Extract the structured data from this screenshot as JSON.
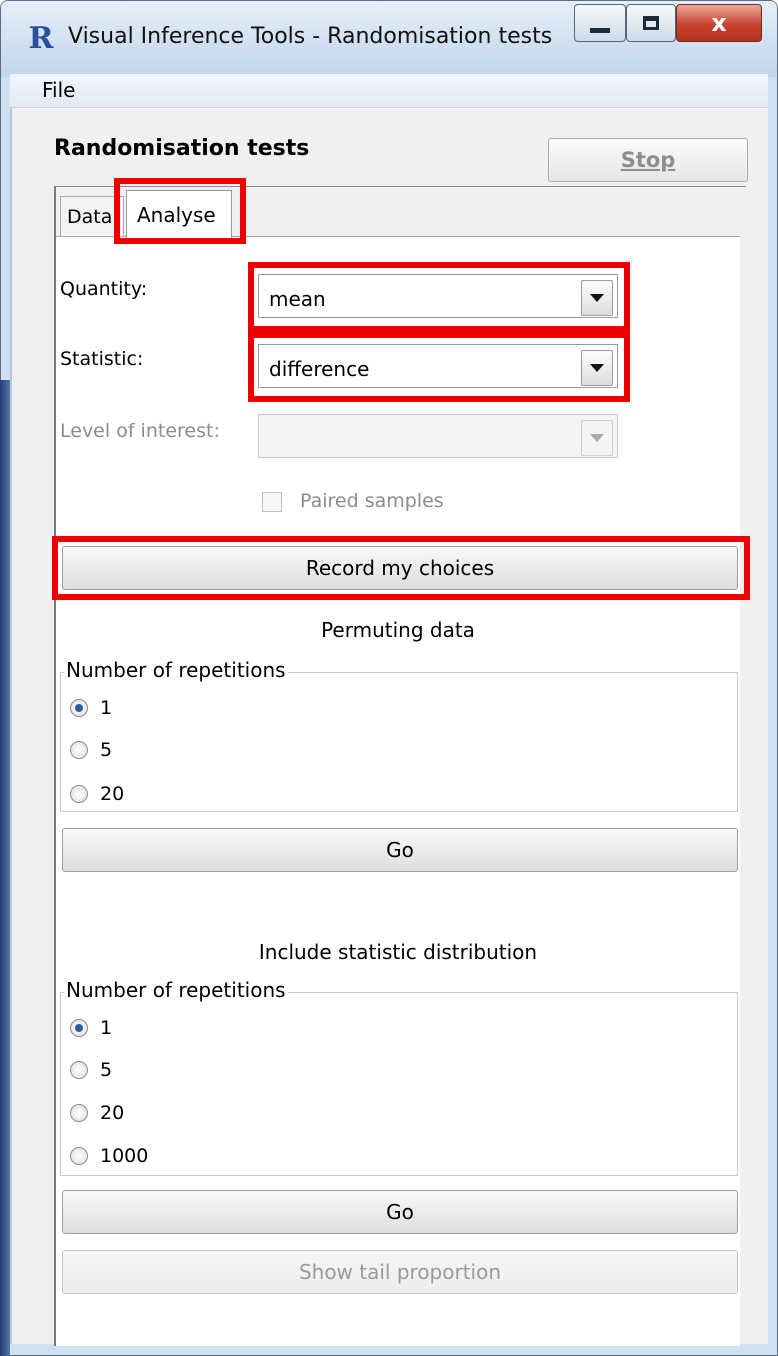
{
  "window": {
    "title": "Visual Inference Tools - Randomisation tests",
    "app_icon_glyph": "R",
    "close_glyph": "x"
  },
  "menu": {
    "file": "File"
  },
  "header": {
    "heading": "Randomisation tests",
    "stop_label": "Stop"
  },
  "tabs": [
    {
      "label": "Data"
    },
    {
      "label": "Analyse",
      "selected": true
    }
  ],
  "analyse": {
    "quantity": {
      "label": "Quantity:",
      "value": "mean"
    },
    "statistic": {
      "label": "Statistic:",
      "value": "difference"
    },
    "level": {
      "label": "Level of interest:",
      "value": "",
      "enabled": false
    },
    "paired": {
      "label": "Paired samples",
      "checked": false,
      "enabled": false
    },
    "record_label": "Record my choices"
  },
  "permuting": {
    "title": "Permuting data",
    "group_label": "Number of repetitions",
    "options": [
      "1",
      "5",
      "20"
    ],
    "selected_index": 0,
    "go_label": "Go"
  },
  "distribution": {
    "title": "Include statistic distribution",
    "group_label": "Number of repetitions",
    "options": [
      "1",
      "5",
      "20",
      "1000"
    ],
    "selected_index": 0,
    "go_label": "Go",
    "tail_label": "Show tail proportion"
  },
  "colors": {
    "highlight": "#ee0000",
    "radio_dot": "#2d5aa8"
  }
}
